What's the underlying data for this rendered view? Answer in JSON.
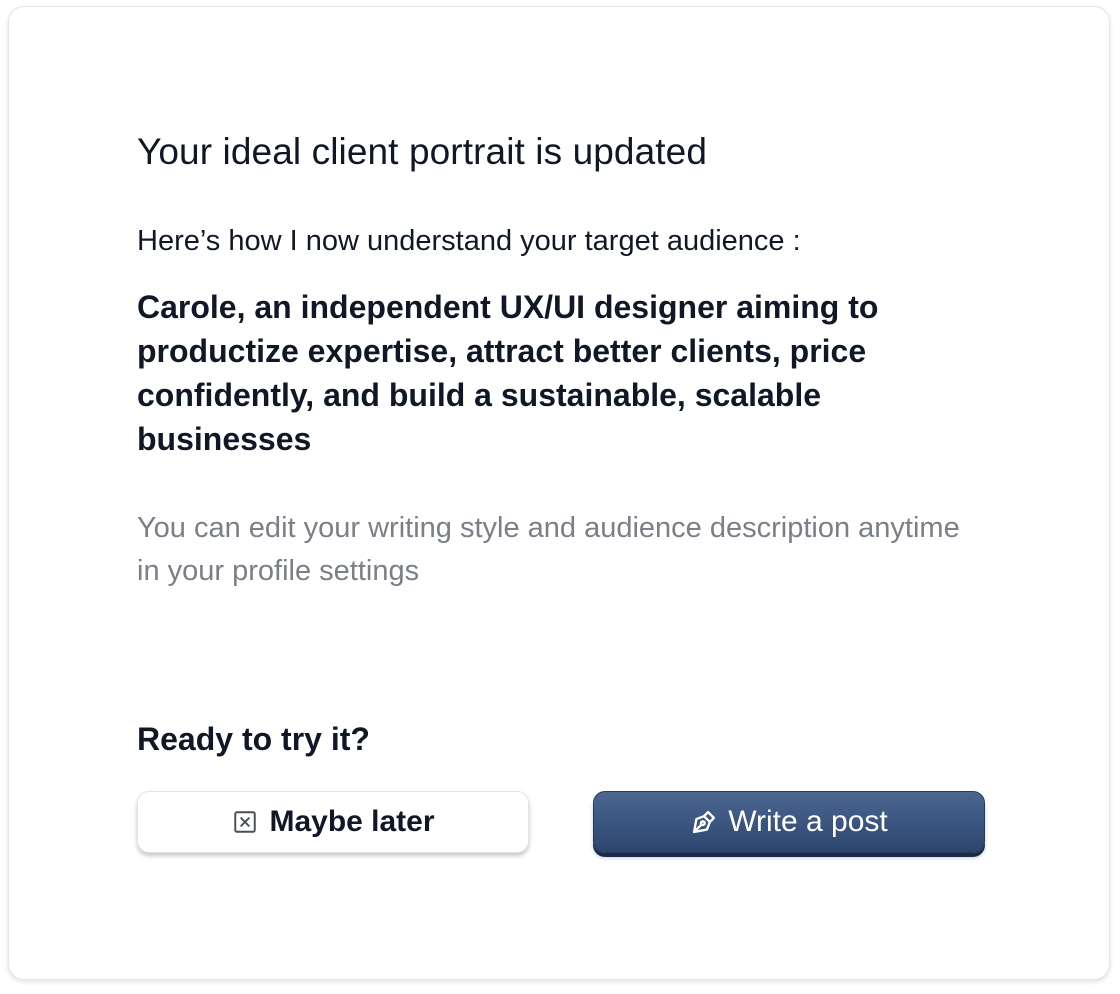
{
  "dialog": {
    "title": "Your ideal client portrait is updated",
    "intro": "Here’s how I now understand your target audience :",
    "portrait": "Carole, an independent UX/UI designer aiming to productize expertise, attract better clients, price confidently, and build a sustainable, scalable businesses",
    "note": "You can edit your writing style and audience description anytime in your profile settings",
    "cta_question": "Ready to try it?",
    "buttons": {
      "later_label": "Maybe later",
      "later_icon": "close-square-icon",
      "write_label": "Write a post",
      "write_icon": "pen-tool-icon"
    }
  },
  "colors": {
    "text": "#101827",
    "muted_text": "#7a7f88",
    "primary": "#3b5680",
    "primary_dark": "#1a2b47"
  }
}
